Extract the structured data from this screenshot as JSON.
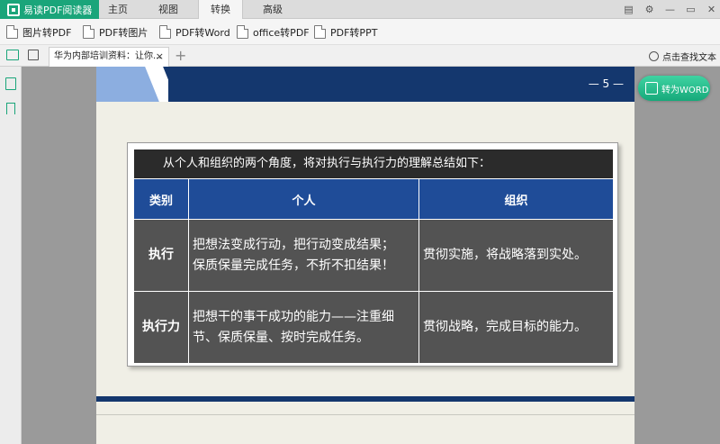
{
  "app": {
    "name": "易读PDF阅读器"
  },
  "menu_tabs": [
    "主页",
    "视图",
    "转换",
    "高级"
  ],
  "active_menu": "转换",
  "toolbar": {
    "items": [
      "图片转PDF",
      "PDF转图片",
      "PDF转Word",
      "office转PDF",
      "PDF转PPT"
    ]
  },
  "document": {
    "tab_title": "华为内部培训资料：让你...",
    "find_text": "点击查找文本",
    "page_number": "— 5 —"
  },
  "convert_button": "转为WORD",
  "slide": {
    "caption": "从个人和组织的两个角度，将对执行与执行力的理解总结如下：",
    "headers": [
      "类别",
      "个人",
      "组织"
    ],
    "rows": [
      {
        "category": "执行",
        "personal_line1": "把想法变成行动，把行动变成结果；",
        "personal_line2": "保质保量完成任务，不折不扣结果！",
        "org": "贯彻实施，将战略落到实处。"
      },
      {
        "category": "执行力",
        "personal_line1": "把想干的事干成功的能力——注重细",
        "personal_line2": "节、保质保量、按时完成任务。",
        "org": "贯彻战略，完成目标的能力。"
      }
    ]
  },
  "colors": {
    "brand_green": "#1aa57a",
    "header_blue": "#1f4c98",
    "banner_navy": "#14376e",
    "cell_gray": "#535353"
  }
}
